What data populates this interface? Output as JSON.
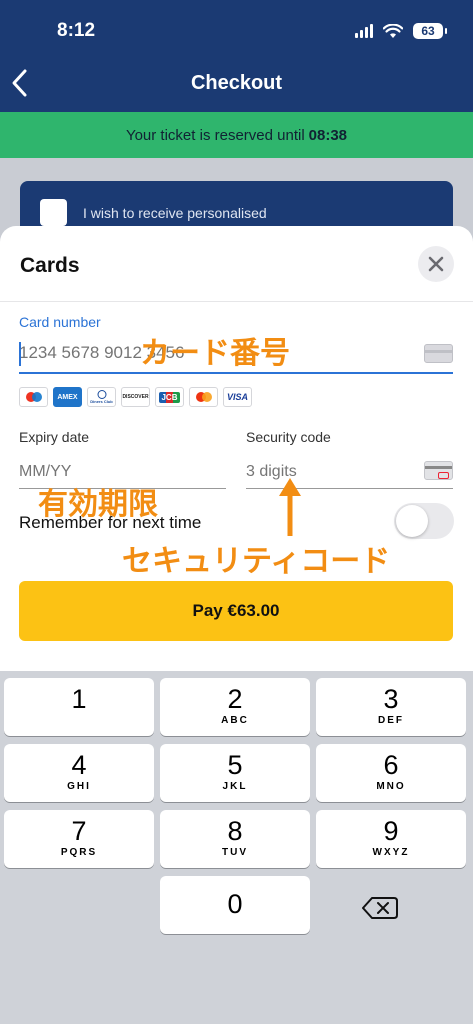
{
  "status": {
    "time": "8:12",
    "battery": "63"
  },
  "nav": {
    "title": "Checkout"
  },
  "banner": {
    "text": "Your ticket is reserved until",
    "time": "08:38"
  },
  "consent": {
    "text": "I wish to receive personalised"
  },
  "sheet": {
    "title": "Cards",
    "card_number_label": "Card number",
    "card_number_placeholder": "1234 5678 9012 3456",
    "brands": [
      "maestro-icon",
      "amex-icon",
      "diners-club-icon",
      "discover-icon",
      "jcb-icon",
      "mastercard-icon",
      "visa-icon"
    ],
    "brand_labels": {
      "amex": "AMEX",
      "diners": "Diners Club",
      "discover": "DISCOVER",
      "jcb": "JCB",
      "visa": "VISA"
    },
    "expiry_label": "Expiry date",
    "expiry_placeholder": "MM/YY",
    "security_label": "Security code",
    "security_placeholder": "3 digits",
    "remember_label": "Remember for next time",
    "remember_on": false,
    "pay_label": "Pay €63.00"
  },
  "annotations": {
    "card_number": "カード番号",
    "expiry": "有効期限",
    "security": "セキュリティコード",
    "color": "#f28d13"
  },
  "keypad": {
    "keys": [
      {
        "num": "1",
        "letters": ""
      },
      {
        "num": "2",
        "letters": "ABC"
      },
      {
        "num": "3",
        "letters": "DEF"
      },
      {
        "num": "4",
        "letters": "GHI"
      },
      {
        "num": "5",
        "letters": "JKL"
      },
      {
        "num": "6",
        "letters": "MNO"
      },
      {
        "num": "7",
        "letters": "PQRS"
      },
      {
        "num": "8",
        "letters": "TUV"
      },
      {
        "num": "9",
        "letters": "WXYZ"
      },
      {
        "num": "0",
        "letters": ""
      }
    ]
  },
  "colors": {
    "brand_navy": "#1b3a73",
    "banner_green": "#2fb56d",
    "pay_yellow": "#fcc214",
    "accent_blue": "#2b73d6"
  }
}
